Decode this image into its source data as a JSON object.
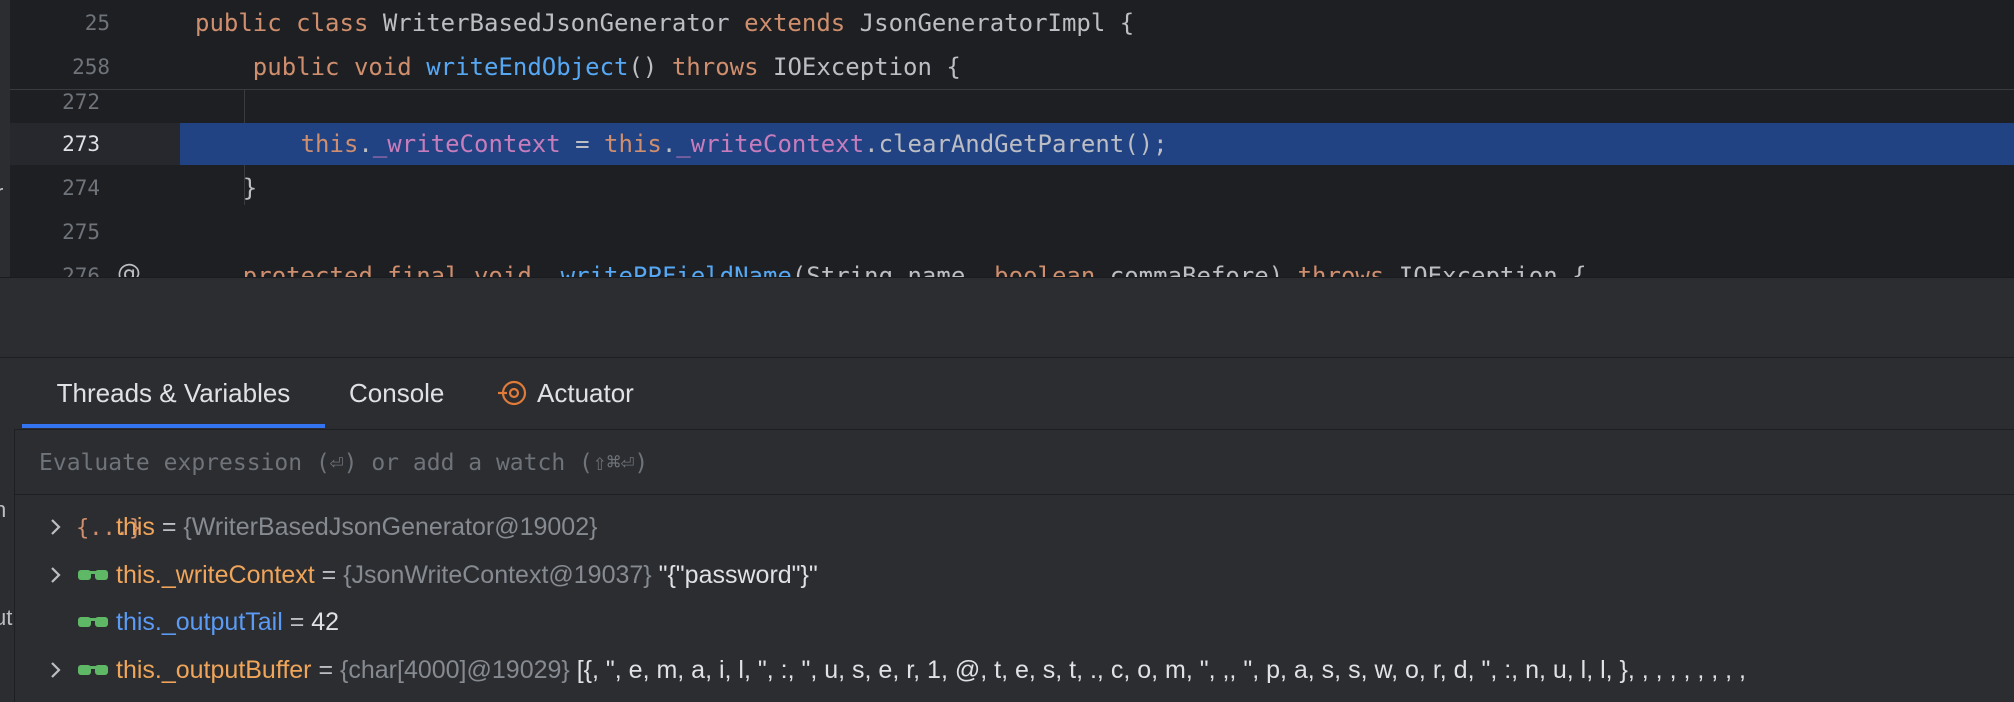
{
  "editor": {
    "sticky_lines": [
      {
        "number": "25",
        "tokens": [
          {
            "text": "public class ",
            "cls": "kw"
          },
          {
            "text": "WriterBasedJsonGenerator ",
            "cls": ""
          },
          {
            "text": "extends ",
            "cls": "kw"
          },
          {
            "text": "JsonGeneratorImpl {",
            "cls": ""
          }
        ]
      },
      {
        "number": "258",
        "tokens": [
          {
            "text": "    public void ",
            "cls": "kw"
          },
          {
            "text": "writeEndObject",
            "cls": "fn"
          },
          {
            "text": "() ",
            "cls": ""
          },
          {
            "text": "throws ",
            "cls": "kw"
          },
          {
            "text": "IOException {",
            "cls": ""
          }
        ]
      }
    ],
    "lines": [
      {
        "number": "272",
        "tokens": []
      },
      {
        "number": "273",
        "current": true,
        "tokens": [
          {
            "text": "        this",
            "cls": "kw"
          },
          {
            "text": ".",
            "cls": ""
          },
          {
            "text": "_writeContext",
            "cls": "fld"
          },
          {
            "text": " = ",
            "cls": ""
          },
          {
            "text": "this",
            "cls": "kw"
          },
          {
            "text": ".",
            "cls": ""
          },
          {
            "text": "_writeContext",
            "cls": "fld"
          },
          {
            "text": ".clearAndGetParent();",
            "cls": ""
          }
        ]
      },
      {
        "number": "274",
        "tokens": [
          {
            "text": "    }",
            "cls": ""
          }
        ]
      },
      {
        "number": "275",
        "tokens": []
      },
      {
        "number": "276",
        "tokens": [
          {
            "text": "    protected final void ",
            "cls": "kw"
          },
          {
            "text": "_writePPFieldName",
            "cls": "fn"
          },
          {
            "text": "(String name, ",
            "cls": ""
          },
          {
            "text": "boolean ",
            "cls": "kw"
          },
          {
            "text": "commaBefore) ",
            "cls": ""
          },
          {
            "text": "throws ",
            "cls": "kw"
          },
          {
            "text": "IOException {",
            "cls": ""
          }
        ]
      }
    ],
    "left_strip_letter": "r",
    "gutter_icon": "override-annotation-icon",
    "gutter_glyph": "@"
  },
  "tool_window": {
    "tabs": [
      {
        "label": "Threads & Variables",
        "active": true
      },
      {
        "label": "Console",
        "active": false
      },
      {
        "label": "Actuator",
        "active": false,
        "icon": "actuator-icon"
      }
    ],
    "evaluate": {
      "placeholder": "Evaluate expression (⏎) or add a watch (⇧⌘⏎)",
      "value": ""
    },
    "left_strip_letters": [
      "n",
      "ut"
    ],
    "variables": [
      {
        "expandable": true,
        "icon": "object-icon",
        "icon_glyph": "{...}",
        "name": "this",
        "name_color": "orange",
        "equals": " = ",
        "ref": "{WriterBasedJsonGenerator@19002}",
        "value": ""
      },
      {
        "expandable": true,
        "icon": "watch-glasses-icon",
        "name": "this._writeContext",
        "name_color": "orange",
        "equals": " = ",
        "ref": "{JsonWriteContext@19037}",
        "value": " \"{\"password\"}\""
      },
      {
        "expandable": false,
        "icon": "watch-glasses-icon",
        "name": "this._outputTail",
        "name_color": "blue",
        "equals": " = ",
        "ref": "",
        "value": "42"
      },
      {
        "expandable": true,
        "icon": "watch-glasses-icon",
        "name": "this._outputBuffer",
        "name_color": "orange",
        "equals": " = ",
        "ref": "{char[4000]@19029}",
        "value": " [{, \", e, m, a, i, l, \", :, \", u, s, e, r, 1, @, t, e, s, t, ., c, o, m, \", ,, \", p, a, s, s, w, o, r, d, \", :, n, u, l, l, }, , , , , , , , ,"
      }
    ]
  },
  "colors": {
    "editor_bg": "#1e1f22",
    "panel_bg": "#2b2d30",
    "current_line": "#214283",
    "tab_underline": "#3574f0",
    "keyword": "#cf8e6d",
    "method": "#56a8f5",
    "field": "#c77dbb",
    "watch_icon": "#5fb865"
  }
}
